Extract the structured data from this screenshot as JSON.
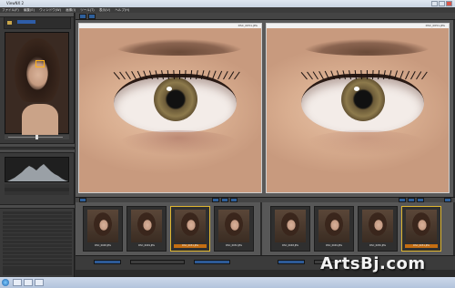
{
  "window": {
    "title": "ViewNX 2"
  },
  "menu": [
    "ファイル(F)",
    "編集(E)",
    "ウィンドウ(W)",
    "画像(I)",
    "ツール(T)",
    "表示(V)",
    "ヘルプ(H)"
  ],
  "panes": [
    {
      "label": "DSC_0051.JPG"
    },
    {
      "label": "DSC_0051.JPG"
    }
  ],
  "filmstrip": {
    "left": [
      {
        "caption": "DSC_0048.JPG",
        "selected": false
      },
      {
        "caption": "DSC_0049.JPG",
        "selected": false
      },
      {
        "caption": "DSC_0051.JPG",
        "selected": true
      },
      {
        "caption": "DSC_0052.JPG",
        "selected": false
      }
    ],
    "right": [
      {
        "caption": "DSC_0048.JPG",
        "selected": false
      },
      {
        "caption": "DSC_0049.JPG",
        "selected": false
      },
      {
        "caption": "DSC_0050.JPG",
        "selected": false
      },
      {
        "caption": "DSC_0051.JPG",
        "selected": true
      }
    ]
  },
  "watermark": "ArtsBj.com",
  "colors": {
    "accent": "#e0b630",
    "selected_caption": "#c46d12",
    "nav_rect": "#ffb21a"
  },
  "icons": [
    "folder-icon",
    "navigator-rect",
    "histogram-icon",
    "start-icon"
  ]
}
